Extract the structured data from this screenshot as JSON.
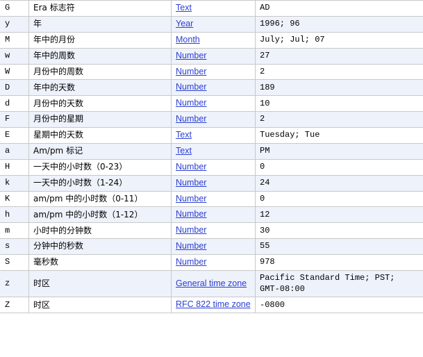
{
  "table": {
    "columns": [
      "letter",
      "description",
      "type",
      "example"
    ],
    "rows": [
      {
        "letter": "G",
        "description": "Era 标志符",
        "type": "Text",
        "example": "AD",
        "shaded": false
      },
      {
        "letter": "y",
        "description": "年",
        "type": "Year",
        "example": "1996; 96",
        "shaded": true
      },
      {
        "letter": "M",
        "description": "年中的月份",
        "type": "Month",
        "example": "July; Jul; 07",
        "shaded": false
      },
      {
        "letter": "w",
        "description": "年中的周数",
        "type": "Number",
        "example": "27",
        "shaded": true
      },
      {
        "letter": "W",
        "description": "月份中的周数",
        "type": "Number",
        "example": "2",
        "shaded": false
      },
      {
        "letter": "D",
        "description": "年中的天数",
        "type": "Number",
        "example": "189",
        "shaded": true
      },
      {
        "letter": "d",
        "description": "月份中的天数",
        "type": "Number",
        "example": "10",
        "shaded": false
      },
      {
        "letter": "F",
        "description": "月份中的星期",
        "type": "Number",
        "example": "2",
        "shaded": true
      },
      {
        "letter": "E",
        "description": "星期中的天数",
        "type": "Text",
        "example": "Tuesday; Tue",
        "shaded": false
      },
      {
        "letter": "a",
        "description": "Am/pm 标记",
        "type": "Text",
        "example": "PM",
        "shaded": true
      },
      {
        "letter": "H",
        "description": "一天中的小时数（0-23）",
        "type": "Number",
        "example": "0",
        "shaded": false
      },
      {
        "letter": "k",
        "description": "一天中的小时数（1-24）",
        "type": "Number",
        "example": "24",
        "shaded": true
      },
      {
        "letter": "K",
        "description": "am/pm 中的小时数（0-11）",
        "type": "Number",
        "example": "0",
        "shaded": false
      },
      {
        "letter": "h",
        "description": "am/pm 中的小时数（1-12）",
        "type": "Number",
        "example": "12",
        "shaded": true
      },
      {
        "letter": "m",
        "description": "小时中的分钟数",
        "type": "Number",
        "example": "30",
        "shaded": false
      },
      {
        "letter": "s",
        "description": "分钟中的秒数",
        "type": "Number",
        "example": "55",
        "shaded": true
      },
      {
        "letter": "S",
        "description": "毫秒数",
        "type": "Number",
        "example": "978",
        "shaded": false
      },
      {
        "letter": "z",
        "description": "时区",
        "type": "General time zone",
        "example": "Pacific Standard Time; PST; GMT-08:00",
        "shaded": true
      },
      {
        "letter": "Z",
        "description": "时区",
        "type": "RFC 822 time zone",
        "example": "-0800",
        "shaded": false
      }
    ]
  },
  "colors": {
    "link": "#2b3fd1",
    "row_shade": "#eef2fb",
    "border": "#c8c8c8"
  }
}
